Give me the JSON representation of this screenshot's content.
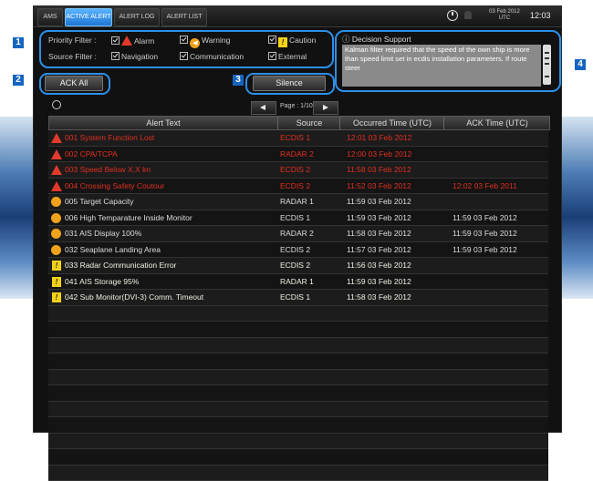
{
  "tabs": [
    "AMS",
    "ACTIVE ALERT",
    "ALERT LOG",
    "ALERT LIST"
  ],
  "status": {
    "date": "03 Feb 2012",
    "zone": "UTC",
    "time": "12:03"
  },
  "filters": {
    "priority_label": "Priority Filter :",
    "alarm": "Alarm",
    "warning": "Warning",
    "caution": "Caution",
    "source_label": "Source Filter :",
    "navigation": "Navigation",
    "communication": "Communication",
    "external": "External"
  },
  "decision": {
    "title": "Decision Support",
    "text": "Kalman filter required that the speed of the own ship is more than speed limit set in ecdis installation parameters. If route steer"
  },
  "buttons": {
    "ack_all": "ACK All",
    "silence": "Silence"
  },
  "pager": {
    "label": "Page : 1/10"
  },
  "callouts": [
    "1",
    "2",
    "3",
    "4"
  ],
  "table": {
    "headers": [
      "Alert Text",
      "Source",
      "Occurred Time (UTC)",
      "ACK Time (UTC)"
    ],
    "rows": [
      {
        "priority": "alarm",
        "num": "001",
        "text": "System Function Lost",
        "source": "ECDIS 1",
        "occurred": "12:01  03 Feb 2012",
        "ack": ""
      },
      {
        "priority": "alarm",
        "num": "002",
        "text": "CPA/TCPA",
        "source": "RADAR 2",
        "occurred": "12:00  03 Feb 2012",
        "ack": ""
      },
      {
        "priority": "alarm",
        "num": "003",
        "text": "Speed Below X.X kn",
        "source": "ECDIS 2",
        "occurred": "11:58  03 Feb 2012",
        "ack": ""
      },
      {
        "priority": "alarm",
        "num": "004",
        "text": "Crossing Safety Coutour",
        "source": "ECDIS 2",
        "occurred": "11:52  03 Feb 2012",
        "ack": "12:02  03 Feb 2011"
      },
      {
        "priority": "warning",
        "num": "005",
        "text": "Target Capacity",
        "source": "RADAR 1",
        "occurred": "11:59  03 Feb 2012",
        "ack": ""
      },
      {
        "priority": "warning",
        "num": "006",
        "text": "High Temparature Inside Monitor",
        "source": "ECDIS 1",
        "occurred": "11:59  03 Feb 2012",
        "ack": "11:59  03 Feb 2012"
      },
      {
        "priority": "warning",
        "num": "031",
        "text": "AIS Display 100%",
        "source": "RADAR 2",
        "occurred": "11:58  03 Feb 2012",
        "ack": "11:59  03 Feb 2012"
      },
      {
        "priority": "warning",
        "num": "032",
        "text": "Seaplane Landing Area",
        "source": "ECDIS 2",
        "occurred": "11:57  03 Feb 2012",
        "ack": "11:59  03 Feb 2012"
      },
      {
        "priority": "caution",
        "num": "033",
        "text": "Radar Communication Error",
        "source": "ECDIS 2",
        "occurred": "11:56  03 Feb 2012",
        "ack": ""
      },
      {
        "priority": "caution",
        "num": "041",
        "text": "AIS Storage 95%",
        "source": "RADAR 1",
        "occurred": "11:59  03 Feb 2012",
        "ack": ""
      },
      {
        "priority": "caution",
        "num": "042",
        "text": "Sub Monitor(DVI-3) Comm. Timeout",
        "source": "ECDIS 1",
        "occurred": "11:58  03 Feb 2012",
        "ack": ""
      }
    ]
  },
  "colors": {
    "accent": "#2d8fe6",
    "alarm": "#e0301f",
    "warning": "#f0a21a",
    "caution": "#f3d217",
    "active_tab": "#1f76d3"
  }
}
